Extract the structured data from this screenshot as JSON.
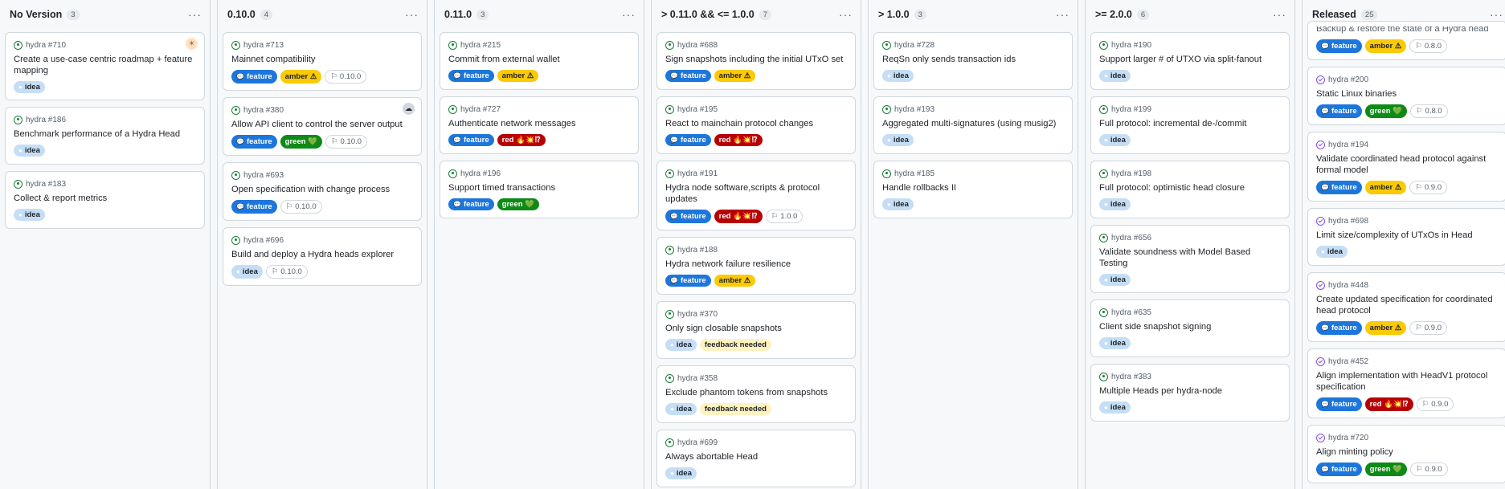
{
  "columns": [
    {
      "title": "No Version",
      "count": "3",
      "cards": [
        {
          "ref": "hydra #710",
          "title": "Create a use-case centric roadmap + feature mapping",
          "labels": [
            {
              "t": "idea",
              "k": "idea"
            }
          ],
          "avatar": "av1"
        },
        {
          "ref": "hydra #186",
          "title": "Benchmark performance of a Hydra Head",
          "labels": [
            {
              "t": "idea",
              "k": "idea"
            }
          ]
        },
        {
          "ref": "hydra #183",
          "title": "Collect & report metrics",
          "labels": [
            {
              "t": "idea",
              "k": "idea"
            }
          ]
        }
      ]
    },
    {
      "title": "0.10.0",
      "count": "4",
      "cards": [
        {
          "ref": "hydra #713",
          "title": "Mainnet compatibility",
          "labels": [
            {
              "t": "feature",
              "k": "feature"
            },
            {
              "t": "amber ⚠",
              "k": "amber"
            },
            {
              "t": "0.10.0",
              "k": "ms"
            }
          ]
        },
        {
          "ref": "hydra #380",
          "title": "Allow API client to control the server output",
          "labels": [
            {
              "t": "feature",
              "k": "feature"
            },
            {
              "t": "green 💚",
              "k": "green"
            },
            {
              "t": "0.10.0",
              "k": "ms"
            }
          ],
          "avatar": "av2"
        },
        {
          "ref": "hydra #693",
          "title": "Open specification with change process",
          "labels": [
            {
              "t": "feature",
              "k": "feature"
            },
            {
              "t": "0.10.0",
              "k": "ms"
            }
          ]
        },
        {
          "ref": "hydra #696",
          "title": "Build and deploy a Hydra heads explorer",
          "labels": [
            {
              "t": "idea",
              "k": "idea"
            },
            {
              "t": "0.10.0",
              "k": "ms"
            }
          ]
        }
      ]
    },
    {
      "title": "0.11.0",
      "count": "3",
      "cards": [
        {
          "ref": "hydra #215",
          "title": "Commit from external wallet",
          "labels": [
            {
              "t": "feature",
              "k": "feature"
            },
            {
              "t": "amber ⚠",
              "k": "amber"
            }
          ]
        },
        {
          "ref": "hydra #727",
          "title": "Authenticate network messages",
          "labels": [
            {
              "t": "feature",
              "k": "feature"
            },
            {
              "t": "red 🔥💥⁉",
              "k": "red"
            }
          ]
        },
        {
          "ref": "hydra #196",
          "title": "Support timed transactions",
          "labels": [
            {
              "t": "feature",
              "k": "feature"
            },
            {
              "t": "green 💚",
              "k": "green"
            }
          ]
        }
      ]
    },
    {
      "title": "> 0.11.0 && <= 1.0.0",
      "count": "7",
      "cards": [
        {
          "ref": "hydra #688",
          "title": "Sign snapshots including the initial UTxO set",
          "labels": [
            {
              "t": "feature",
              "k": "feature"
            },
            {
              "t": "amber ⚠",
              "k": "amber"
            }
          ]
        },
        {
          "ref": "hydra #195",
          "title": "React to mainchain protocol changes",
          "labels": [
            {
              "t": "feature",
              "k": "feature"
            },
            {
              "t": "red 🔥💥⁉",
              "k": "red"
            }
          ]
        },
        {
          "ref": "hydra #191",
          "title": "Hydra node software,scripts & protocol updates",
          "labels": [
            {
              "t": "feature",
              "k": "feature"
            },
            {
              "t": "red 🔥💥⁉",
              "k": "red"
            },
            {
              "t": "1.0.0",
              "k": "ms"
            }
          ]
        },
        {
          "ref": "hydra #188",
          "title": "Hydra network failure resilience",
          "labels": [
            {
              "t": "feature",
              "k": "feature"
            },
            {
              "t": "amber ⚠",
              "k": "amber"
            }
          ]
        },
        {
          "ref": "hydra #370",
          "title": "Only sign closable snapshots",
          "labels": [
            {
              "t": "idea",
              "k": "idea"
            },
            {
              "t": "feedback needed",
              "k": "feedback"
            }
          ]
        },
        {
          "ref": "hydra #358",
          "title": "Exclude phantom tokens from snapshots",
          "labels": [
            {
              "t": "idea",
              "k": "idea"
            },
            {
              "t": "feedback needed",
              "k": "feedback"
            }
          ]
        },
        {
          "ref": "hydra #699",
          "title": "Always abortable Head",
          "labels": [
            {
              "t": "idea",
              "k": "idea"
            }
          ]
        }
      ]
    },
    {
      "title": "> 1.0.0",
      "count": "3",
      "cards": [
        {
          "ref": "hydra #728",
          "title": "ReqSn only sends transaction ids",
          "labels": [
            {
              "t": "idea",
              "k": "idea"
            }
          ]
        },
        {
          "ref": "hydra #193",
          "title": "Aggregated multi-signatures (using musig2)",
          "labels": [
            {
              "t": "idea",
              "k": "idea"
            }
          ]
        },
        {
          "ref": "hydra #185",
          "title": "Handle rollbacks II",
          "labels": [
            {
              "t": "idea",
              "k": "idea"
            }
          ]
        }
      ]
    },
    {
      "title": ">= 2.0.0",
      "count": "6",
      "cards": [
        {
          "ref": "hydra #190",
          "title": "Support larger # of UTXO via split-fanout",
          "labels": [
            {
              "t": "idea",
              "k": "idea"
            }
          ]
        },
        {
          "ref": "hydra #199",
          "title": "Full protocol: incremental de-/commit",
          "labels": [
            {
              "t": "idea",
              "k": "idea"
            }
          ]
        },
        {
          "ref": "hydra #198",
          "title": "Full protocol: optimistic head closure",
          "labels": [
            {
              "t": "idea",
              "k": "idea"
            }
          ]
        },
        {
          "ref": "hydra #656",
          "title": "Validate soundness with Model Based Testing",
          "labels": [
            {
              "t": "idea",
              "k": "idea"
            }
          ]
        },
        {
          "ref": "hydra #635",
          "title": "Client side snapshot signing",
          "labels": [
            {
              "t": "idea",
              "k": "idea"
            }
          ]
        },
        {
          "ref": "hydra #383",
          "title": "Multiple Heads per hydra-node",
          "labels": [
            {
              "t": "idea",
              "k": "idea"
            }
          ]
        }
      ]
    },
    {
      "title": "Released",
      "count": "25",
      "shifted": true,
      "cards": [
        {
          "ref": "",
          "title": "Backup & restore the state of a Hydra head",
          "labels": [
            {
              "t": "feature",
              "k": "feature"
            },
            {
              "t": "amber ⚠",
              "k": "amber"
            },
            {
              "t": "0.8.0",
              "k": "ms"
            }
          ],
          "done": true,
          "partial": true
        },
        {
          "ref": "hydra #200",
          "title": "Static Linux binaries",
          "labels": [
            {
              "t": "feature",
              "k": "feature"
            },
            {
              "t": "green 💚",
              "k": "green"
            },
            {
              "t": "0.8.0",
              "k": "ms"
            }
          ],
          "done": true
        },
        {
          "ref": "hydra #194",
          "title": "Validate coordinated head protocol against formal model",
          "labels": [
            {
              "t": "feature",
              "k": "feature"
            },
            {
              "t": "amber ⚠",
              "k": "amber"
            },
            {
              "t": "0.9.0",
              "k": "ms"
            }
          ],
          "done": true
        },
        {
          "ref": "hydra #698",
          "title": "Limit size/complexity of UTxOs in Head",
          "labels": [
            {
              "t": "idea",
              "k": "idea"
            }
          ],
          "done": true
        },
        {
          "ref": "hydra #448",
          "title": "Create updated specification for coordinated head protocol",
          "labels": [
            {
              "t": "feature",
              "k": "feature"
            },
            {
              "t": "amber ⚠",
              "k": "amber"
            },
            {
              "t": "0.9.0",
              "k": "ms"
            }
          ],
          "done": true
        },
        {
          "ref": "hydra #452",
          "title": "Align implementation with HeadV1 protocol specification",
          "labels": [
            {
              "t": "feature",
              "k": "feature"
            },
            {
              "t": "red 🔥💥⁉",
              "k": "red"
            },
            {
              "t": "0.9.0",
              "k": "ms"
            }
          ],
          "done": true
        },
        {
          "ref": "hydra #720",
          "title": "Align minting policy",
          "labels": [
            {
              "t": "feature",
              "k": "feature"
            },
            {
              "t": "green 💚",
              "k": "green"
            },
            {
              "t": "0.9.0",
              "k": "ms"
            }
          ],
          "done": true
        }
      ]
    }
  ]
}
